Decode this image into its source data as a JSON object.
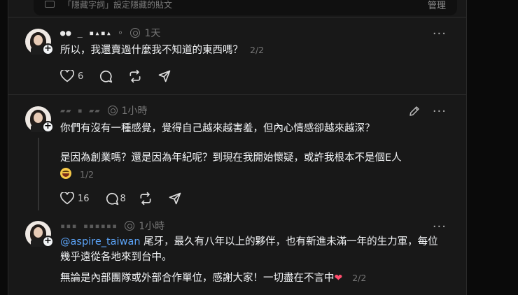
{
  "banner": {
    "text": "「隱藏字詞」設定隱藏的貼文",
    "manage_label": "管理"
  },
  "posts": [
    {
      "username_masked": "●● _ ▪▴▪▴ ◦",
      "time": "1天",
      "lines": [
        "所以，我還賣過什麼我不知道的東西嗎？"
      ],
      "page": "2/2",
      "likes": "6",
      "replies": "",
      "actions": [
        "heart-icon",
        "comment-icon",
        "repost-icon",
        "share-icon"
      ]
    },
    {
      "username_masked": "▰▰ ▪  ▰▰",
      "time": "1小時",
      "lines": [
        "你們有沒有一種感覺，覺得自己越來越害羞，但內心情感卻越來越深？",
        "是因為創業嗎？還是因為年紀呢？到現在我開始懷疑，或許我根本不是個E人"
      ],
      "page": "1/2",
      "likes": "16",
      "replies": "8",
      "actions": [
        "heart-icon",
        "comment-icon",
        "repost-icon",
        "share-icon"
      ]
    },
    {
      "username_masked": "▪▪▪ ▪▪▪▪▪▪",
      "time": "1小時",
      "mention": "@aspire_taiwan",
      "line1_rest": " 尾牙，最久有八年以上的夥伴，也有新進未滿一年的生力軍，每位幾乎遠從各地來到台中。",
      "line2": "無論是內部團隊或外部合作單位，感謝大家！一切盡在不言中",
      "page": "2/2"
    }
  ],
  "colors": {
    "background": "#0a0a0a",
    "card": "#181818",
    "mention": "#5ba3f7",
    "muted": "#777777"
  }
}
